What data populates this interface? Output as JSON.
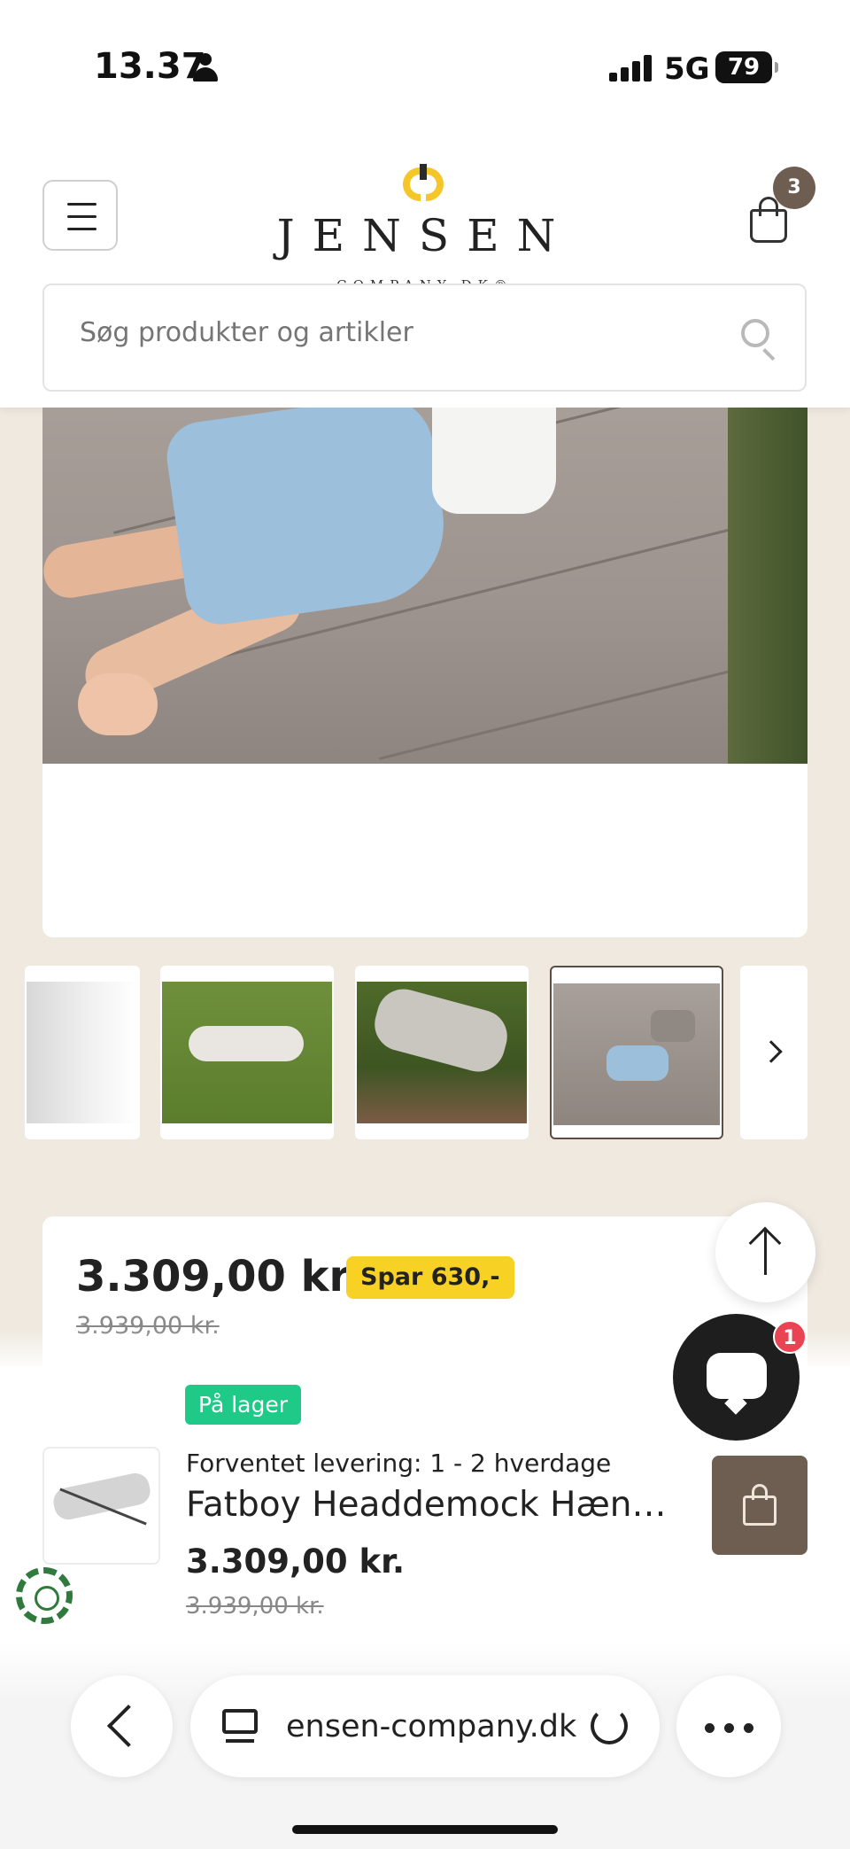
{
  "status_bar": {
    "time": "13.37",
    "network": "5G",
    "battery": "79"
  },
  "header": {
    "logo_word": "JENSEN",
    "logo_sub": "COMPANY.DK®",
    "cart_count": "3",
    "search_placeholder": "Søg produkter og artikler"
  },
  "thumbnails": [
    "hammock-side",
    "hammock-on-lawn",
    "child-in-hammock-lawn",
    "child-lying-close-up"
  ],
  "price": {
    "current": "3.309,00 kr.",
    "save_badge": "Spar 630,-",
    "old": "3.939,00 kr."
  },
  "sticky_bar": {
    "stock": "På lager",
    "delivery": "Forventet levering: 1 - 2 hverdage",
    "product_name": "Fatboy Headdemock Hængekøje",
    "price": "3.309,00 kr.",
    "old_price": "3.939,00 kr."
  },
  "chat": {
    "badge": "1"
  },
  "browser": {
    "url": "ensen-company.dk"
  },
  "colors": {
    "accent_brown": "#6d5e51",
    "save_yellow": "#f7d224",
    "stock_green": "#1fc987",
    "chat_badge": "#e94454",
    "background": "#efe9e0"
  }
}
